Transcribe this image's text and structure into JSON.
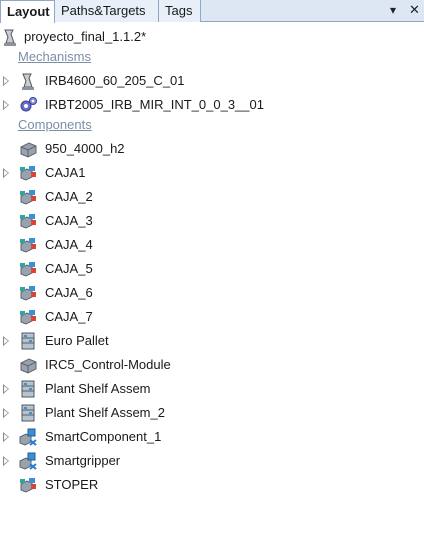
{
  "tabs": {
    "layout": "Layout",
    "paths": "Paths&Targets",
    "tags": "Tags"
  },
  "window_buttons": {
    "pin": "▾",
    "close": "✕"
  },
  "root": {
    "label": "proyecto_final_1.1.2*",
    "icon": "station-icon"
  },
  "sections": {
    "mechanisms": "Mechanisms",
    "components": "Components"
  },
  "mechanisms": [
    {
      "label": "IRB4600_60_205_C_01",
      "icon": "robot-icon"
    },
    {
      "label": "IRBT2005_IRB_MIR_INT_0_0_3__01",
      "icon": "gear-mechanism-icon"
    }
  ],
  "components": [
    {
      "label": "950_4000_h2",
      "icon": "part-icon"
    },
    {
      "label": "CAJA1",
      "icon": "colored-part-icon"
    },
    {
      "label": "CAJA_2",
      "icon": "colored-part-icon"
    },
    {
      "label": "CAJA_3",
      "icon": "colored-part-icon"
    },
    {
      "label": "CAJA_4",
      "icon": "colored-part-icon"
    },
    {
      "label": "CAJA_5",
      "icon": "colored-part-icon"
    },
    {
      "label": "CAJA_6",
      "icon": "colored-part-icon"
    },
    {
      "label": "CAJA_7",
      "icon": "colored-part-icon"
    },
    {
      "label": "Euro Pallet",
      "icon": "assembly-icon"
    },
    {
      "label": "IRC5_Control-Module",
      "icon": "part-icon"
    },
    {
      "label": "Plant Shelf Assem",
      "icon": "assembly-icon"
    },
    {
      "label": "Plant Shelf Assem_2",
      "icon": "assembly-icon"
    },
    {
      "label": "SmartComponent_1",
      "icon": "smart-component-icon"
    },
    {
      "label": "Smartgripper",
      "icon": "smart-component-icon"
    },
    {
      "label": "STOPER",
      "icon": "colored-part-icon"
    }
  ],
  "colors": {
    "tab_bar": "#dde7f3",
    "section_header": "#7a8fa6",
    "part_gray": "#9aa3ad",
    "part_blue": "#3a8fd6",
    "part_red": "#d6453a",
    "part_teal": "#2fa79a"
  }
}
